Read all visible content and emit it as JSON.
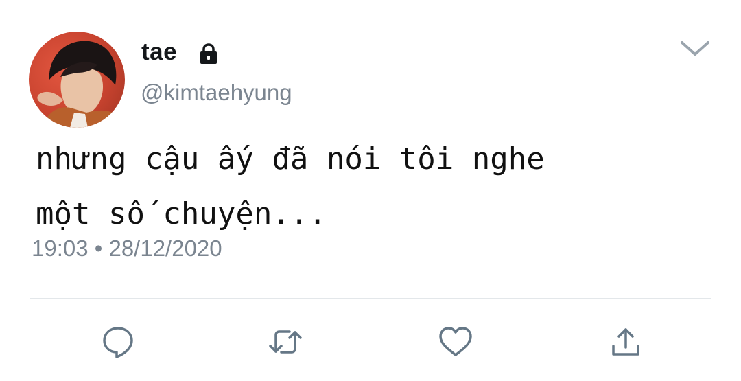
{
  "tweet": {
    "display_name": "tae",
    "handle": "@kimtaehyung",
    "protected_icon": "lock-icon",
    "text_lines": [
      "nhưng cậu ấy đã nói tôi nghe",
      "một số chuyện..."
    ],
    "timestamp": "19:03 • 28/12/2020"
  },
  "header": {
    "menu_icon": "chevron-down-icon"
  },
  "actions": [
    {
      "name": "reply",
      "icon": "speech-bubble-icon"
    },
    {
      "name": "retweet",
      "icon": "retweet-icon"
    },
    {
      "name": "like",
      "icon": "heart-icon"
    },
    {
      "name": "share",
      "icon": "share-icon"
    }
  ],
  "colors": {
    "name_text": "#14171a",
    "secondary_text": "#7b8590",
    "icon": "#657786",
    "divider": "#e3e7ea"
  }
}
